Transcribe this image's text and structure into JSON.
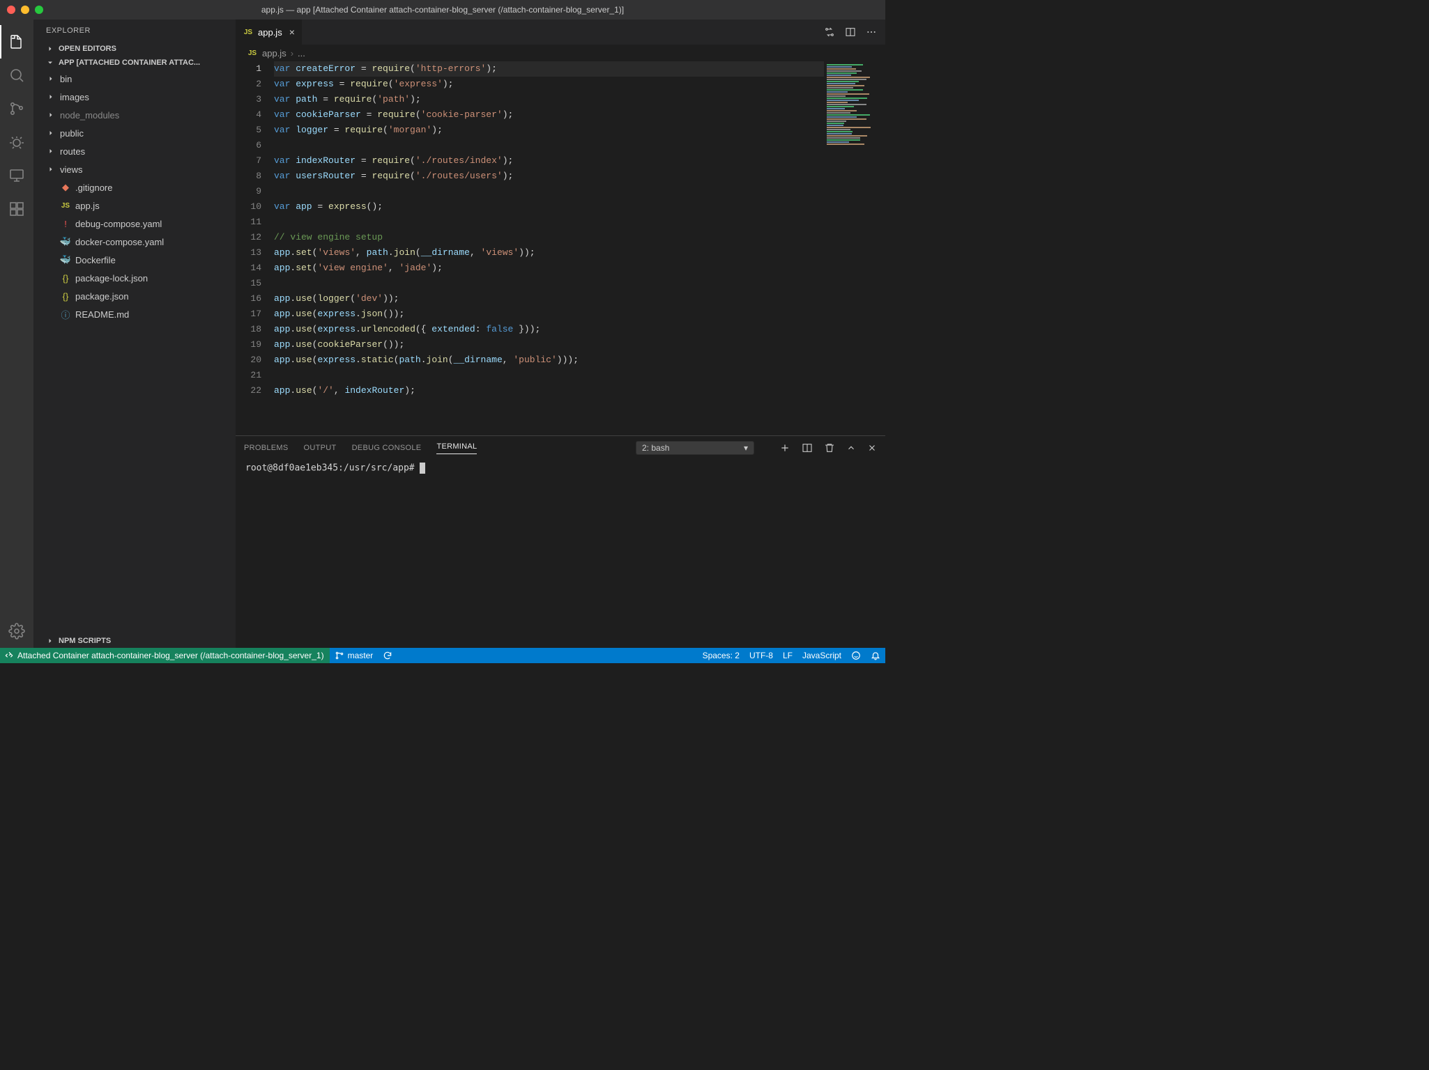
{
  "window": {
    "title": "app.js — app [Attached Container attach-container-blog_server (/attach-container-blog_server_1)]"
  },
  "sidebar": {
    "title": "EXPLORER",
    "sections": {
      "openEditors": "OPEN EDITORS",
      "project": "APP [ATTACHED CONTAINER ATTAC...",
      "npmScripts": "NPM SCRIPTS"
    },
    "folders": [
      {
        "name": "bin"
      },
      {
        "name": "images"
      },
      {
        "name": "node_modules",
        "dim": true
      },
      {
        "name": "public"
      },
      {
        "name": "routes"
      },
      {
        "name": "views"
      }
    ],
    "files": [
      {
        "name": ".gitignore",
        "icon": "git"
      },
      {
        "name": "app.js",
        "icon": "js"
      },
      {
        "name": "debug-compose.yaml",
        "icon": "yaml"
      },
      {
        "name": "docker-compose.yaml",
        "icon": "whale"
      },
      {
        "name": "Dockerfile",
        "icon": "docker"
      },
      {
        "name": "package-lock.json",
        "icon": "json"
      },
      {
        "name": "package.json",
        "icon": "json"
      },
      {
        "name": "README.md",
        "icon": "info"
      }
    ]
  },
  "tab": {
    "label": "app.js"
  },
  "breadcrumb": {
    "file": "app.js",
    "more": "..."
  },
  "code": {
    "lines": [
      [
        [
          "kw",
          "var"
        ],
        [
          "",
          ""
        ],
        [
          "var",
          " createError"
        ],
        [
          "",
          ""
        ],
        [
          "",
          " = "
        ],
        [
          "fn",
          "require"
        ],
        [
          "",
          "("
        ],
        [
          "str",
          "'http-errors'"
        ],
        [
          "",
          ");"
        ]
      ],
      [
        [
          "kw",
          "var"
        ],
        [
          "var",
          " express"
        ],
        [
          "",
          " = "
        ],
        [
          "fn",
          "require"
        ],
        [
          "",
          "("
        ],
        [
          "str",
          "'express'"
        ],
        [
          "",
          ");"
        ]
      ],
      [
        [
          "kw",
          "var"
        ],
        [
          "var",
          " path"
        ],
        [
          "",
          " = "
        ],
        [
          "fn",
          "require"
        ],
        [
          "",
          "("
        ],
        [
          "str",
          "'path'"
        ],
        [
          "",
          ");"
        ]
      ],
      [
        [
          "kw",
          "var"
        ],
        [
          "var",
          " cookieParser"
        ],
        [
          "",
          " = "
        ],
        [
          "fn",
          "require"
        ],
        [
          "",
          "("
        ],
        [
          "str",
          "'cookie-parser'"
        ],
        [
          "",
          ");"
        ]
      ],
      [
        [
          "kw",
          "var"
        ],
        [
          "var",
          " logger"
        ],
        [
          "",
          " = "
        ],
        [
          "fn",
          "require"
        ],
        [
          "",
          "("
        ],
        [
          "str",
          "'morgan'"
        ],
        [
          "",
          ");"
        ]
      ],
      [],
      [
        [
          "kw",
          "var"
        ],
        [
          "var",
          " indexRouter"
        ],
        [
          "",
          " = "
        ],
        [
          "fn",
          "require"
        ],
        [
          "",
          "("
        ],
        [
          "str",
          "'./routes/index'"
        ],
        [
          "",
          ");"
        ]
      ],
      [
        [
          "kw",
          "var"
        ],
        [
          "var",
          " usersRouter"
        ],
        [
          "",
          " = "
        ],
        [
          "fn",
          "require"
        ],
        [
          "",
          "("
        ],
        [
          "str",
          "'./routes/users'"
        ],
        [
          "",
          ");"
        ]
      ],
      [],
      [
        [
          "kw",
          "var"
        ],
        [
          "var",
          " app"
        ],
        [
          "",
          " = "
        ],
        [
          "fn",
          "express"
        ],
        [
          "",
          "();"
        ]
      ],
      [],
      [
        [
          "cmt",
          "// view engine setup"
        ]
      ],
      [
        [
          "var",
          "app"
        ],
        [
          "",
          "."
        ],
        [
          "fn",
          "set"
        ],
        [
          "",
          "("
        ],
        [
          "str",
          "'views'"
        ],
        [
          "",
          ", "
        ],
        [
          "var",
          "path"
        ],
        [
          "",
          "."
        ],
        [
          "fn",
          "join"
        ],
        [
          "",
          "("
        ],
        [
          "var",
          "__dirname"
        ],
        [
          "",
          ", "
        ],
        [
          "str",
          "'views'"
        ],
        [
          "",
          "));"
        ]
      ],
      [
        [
          "var",
          "app"
        ],
        [
          "",
          "."
        ],
        [
          "fn",
          "set"
        ],
        [
          "",
          "("
        ],
        [
          "str",
          "'view engine'"
        ],
        [
          "",
          ", "
        ],
        [
          "str",
          "'jade'"
        ],
        [
          "",
          ");"
        ]
      ],
      [],
      [
        [
          "var",
          "app"
        ],
        [
          "",
          "."
        ],
        [
          "fn",
          "use"
        ],
        [
          "",
          "("
        ],
        [
          "fn",
          "logger"
        ],
        [
          "",
          "("
        ],
        [
          "str",
          "'dev'"
        ],
        [
          "",
          "));"
        ]
      ],
      [
        [
          "var",
          "app"
        ],
        [
          "",
          "."
        ],
        [
          "fn",
          "use"
        ],
        [
          "",
          "("
        ],
        [
          "var",
          "express"
        ],
        [
          "",
          "."
        ],
        [
          "fn",
          "json"
        ],
        [
          "",
          "());"
        ]
      ],
      [
        [
          "var",
          "app"
        ],
        [
          "",
          "."
        ],
        [
          "fn",
          "use"
        ],
        [
          "",
          "("
        ],
        [
          "var",
          "express"
        ],
        [
          "",
          "."
        ],
        [
          "fn",
          "urlencoded"
        ],
        [
          "",
          "({ "
        ],
        [
          "var",
          "extended"
        ],
        [
          "",
          ": "
        ],
        [
          "const",
          "false"
        ],
        [
          "",
          " }));"
        ]
      ],
      [
        [
          "var",
          "app"
        ],
        [
          "",
          "."
        ],
        [
          "fn",
          "use"
        ],
        [
          "",
          "("
        ],
        [
          "fn",
          "cookieParser"
        ],
        [
          "",
          "());"
        ]
      ],
      [
        [
          "var",
          "app"
        ],
        [
          "",
          "."
        ],
        [
          "fn",
          "use"
        ],
        [
          "",
          "("
        ],
        [
          "var",
          "express"
        ],
        [
          "",
          "."
        ],
        [
          "fn",
          "static"
        ],
        [
          "",
          "("
        ],
        [
          "var",
          "path"
        ],
        [
          "",
          "."
        ],
        [
          "fn",
          "join"
        ],
        [
          "",
          "("
        ],
        [
          "var",
          "__dirname"
        ],
        [
          "",
          ", "
        ],
        [
          "str",
          "'public'"
        ],
        [
          "",
          ")));"
        ]
      ],
      [],
      [
        [
          "var",
          "app"
        ],
        [
          "",
          "."
        ],
        [
          "fn",
          "use"
        ],
        [
          "",
          "("
        ],
        [
          "str",
          "'/'"
        ],
        [
          "",
          ", "
        ],
        [
          "var",
          "indexRouter"
        ],
        [
          "",
          ");"
        ]
      ]
    ]
  },
  "panel": {
    "tabs": {
      "problems": "PROBLEMS",
      "output": "OUTPUT",
      "debugConsole": "DEBUG CONSOLE",
      "terminal": "TERMINAL"
    },
    "terminalSelect": "2: bash",
    "terminalPrompt": "root@8df0ae1eb345:/usr/src/app# "
  },
  "status": {
    "remote": "Attached Container attach-container-blog_server (/attach-container-blog_server_1)",
    "branch": "master",
    "spaces": "Spaces: 2",
    "encoding": "UTF-8",
    "eol": "LF",
    "language": "JavaScript"
  }
}
